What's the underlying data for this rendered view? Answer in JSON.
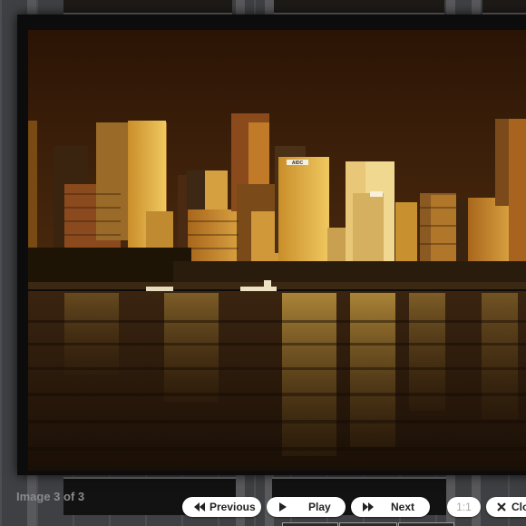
{
  "caption": {
    "text": "Image 3 of 3"
  },
  "controls": {
    "previous_label": "Previous",
    "play_label": "Play",
    "next_label": "Next",
    "zoom_label": "1:1",
    "close_label": "Clo"
  },
  "icons": {
    "previous": "rewind-icon",
    "play": "play-icon",
    "next": "fast-forward-icon",
    "close": "close-x-icon"
  },
  "photo": {
    "subject": "city skyline at dusk reflected in harbour water",
    "sign_text": "AIDC"
  },
  "colors": {
    "sky": "#2e1706",
    "water": "#241407",
    "frame": "#0c0c0c",
    "button_bg": "#ffffff",
    "caption_text": "#8a8a8d",
    "page_bg": "#3f4043"
  }
}
